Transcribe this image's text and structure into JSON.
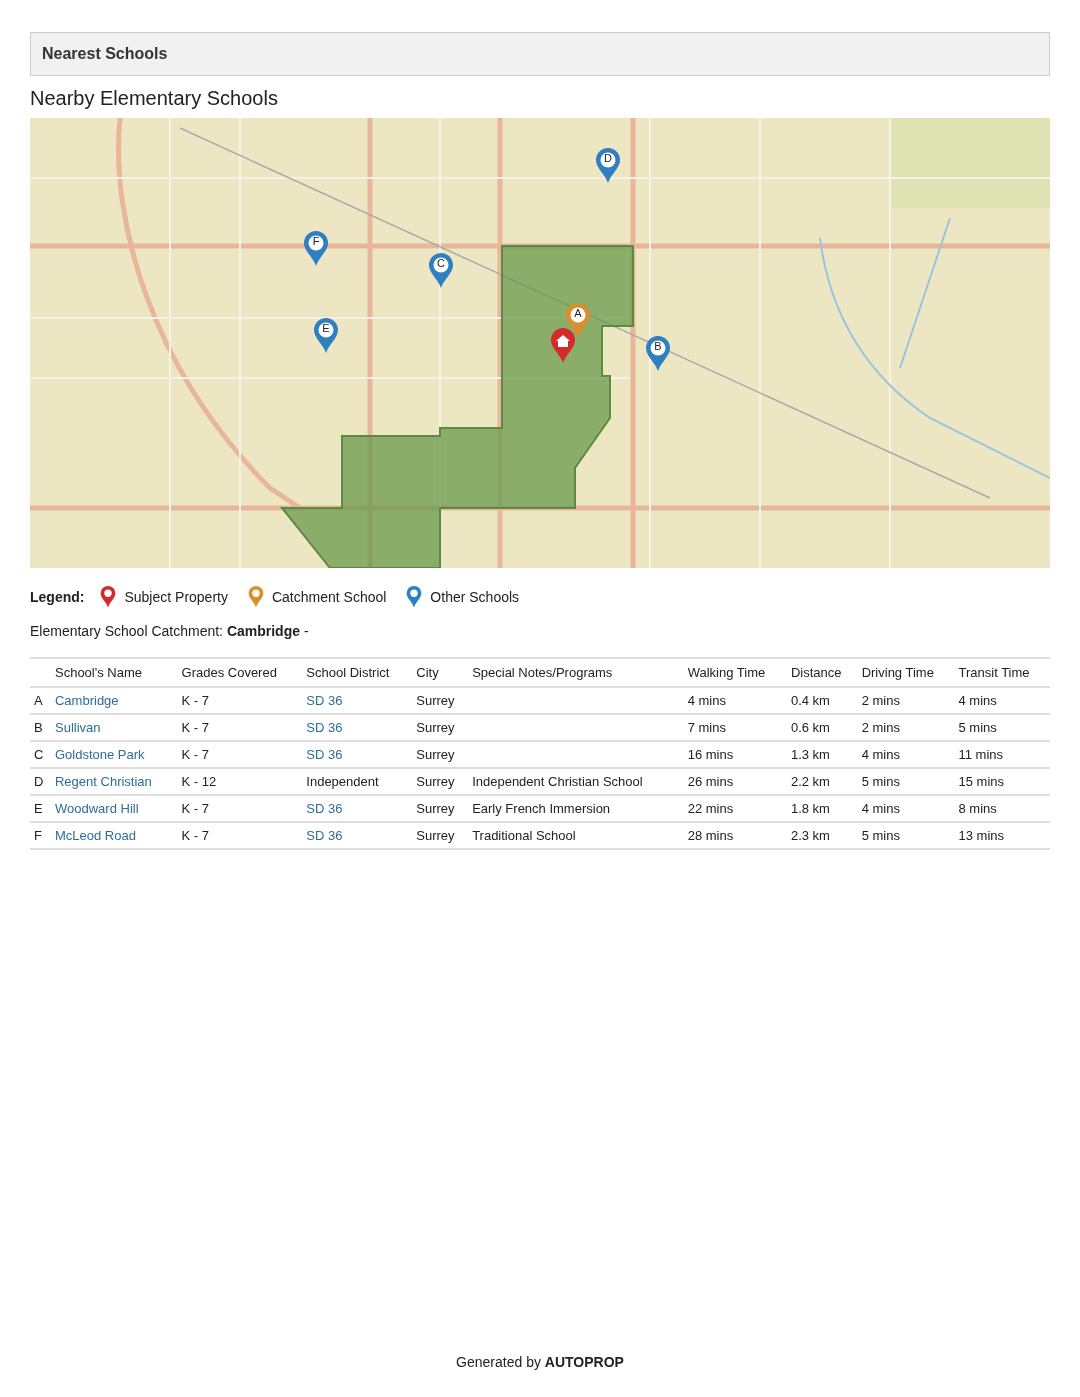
{
  "section_header": {
    "title": "Nearest Schools"
  },
  "heading": "Nearby Elementary Schools",
  "map": {
    "markers": [
      {
        "kind": "subject"
      },
      {
        "kind": "catchment",
        "label": "A"
      },
      {
        "kind": "other",
        "label": "B"
      },
      {
        "kind": "other",
        "label": "C"
      },
      {
        "kind": "other",
        "label": "D"
      },
      {
        "kind": "other",
        "label": "E"
      },
      {
        "kind": "other",
        "label": "F"
      }
    ]
  },
  "legend": {
    "title": "Legend:",
    "items": [
      {
        "kind": "subject",
        "label": "Subject Property"
      },
      {
        "kind": "catchment",
        "label": "Catchment School"
      },
      {
        "kind": "other",
        "label": "Other Schools"
      }
    ]
  },
  "catchment_line": "Elementary School Catchment: **Cambridge** -",
  "table": {
    "columns": [
      "",
      "School's Name",
      "Grades Covered",
      "School District",
      "City",
      "Special Notes/Programs",
      "Walking Time",
      "Distance",
      "Driving Time",
      "Transit Time"
    ],
    "rows": [
      {
        "letter": "A",
        "name": "Cambridge",
        "grades": "K - 7",
        "district": "SD 36",
        "district_link": true,
        "city": "Surrey",
        "notes": "",
        "walking": "4 mins",
        "distance": "0.4 km",
        "driving": "2 mins",
        "transit": "4 mins"
      },
      {
        "letter": "B",
        "name": "Sullivan",
        "grades": "K - 7",
        "district": "SD 36",
        "district_link": true,
        "city": "Surrey",
        "notes": "",
        "walking": "7 mins",
        "distance": "0.6 km",
        "driving": "2 mins",
        "transit": "5 mins"
      },
      {
        "letter": "C",
        "name": "Goldstone Park",
        "grades": "K - 7",
        "district": "SD 36",
        "district_link": true,
        "city": "Surrey",
        "notes": "",
        "walking": "16 mins",
        "distance": "1.3 km",
        "driving": "4 mins",
        "transit": "11 mins"
      },
      {
        "letter": "D",
        "name": "Regent Christian",
        "grades": "K - 12",
        "district": "Independent",
        "district_link": false,
        "city": "Surrey",
        "notes": "Independent Christian School",
        "walking": "26 mins",
        "distance": "2.2 km",
        "driving": "5 mins",
        "transit": "15 mins"
      },
      {
        "letter": "E",
        "name": "Woodward Hill",
        "grades": "K - 7",
        "district": "SD 36",
        "district_link": true,
        "city": "Surrey",
        "notes": "Early French Immersion",
        "walking": "22 mins",
        "distance": "1.8 km",
        "driving": "4 mins",
        "transit": "8 mins"
      },
      {
        "letter": "F",
        "name": "McLeod Road",
        "grades": "K - 7",
        "district": "SD 36",
        "district_link": true,
        "city": "Surrey",
        "notes": "Traditional School",
        "walking": "28 mins",
        "distance": "2.3 km",
        "driving": "5 mins",
        "transit": "13 mins"
      }
    ]
  },
  "footer": "Generated by **AUTOPROP**"
}
